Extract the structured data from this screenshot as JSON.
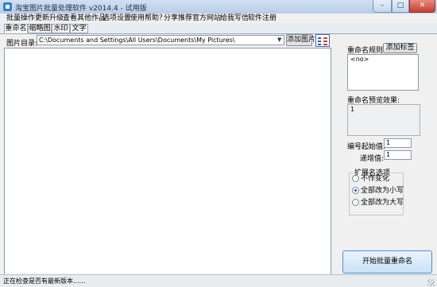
{
  "window": {
    "title": "淘宝图片批量处理软件 v2014.4 - 试用版",
    "minimize_glyph": "–",
    "maximize_glyph": "□",
    "close_glyph": "✕"
  },
  "menu": {
    "items": [
      {
        "label": "批量操作"
      },
      {
        "label": "更新升级"
      },
      {
        "label": "查看其他作品"
      },
      {
        "label": "选项设置"
      },
      {
        "label": "使用帮助？"
      },
      {
        "label": "分享推荐"
      },
      {
        "label": "官方网站"
      },
      {
        "label": "给我写信"
      },
      {
        "label": "软件注册"
      }
    ]
  },
  "tabs": [
    {
      "label": "重命名",
      "active": true
    },
    {
      "label": "缩略图",
      "active": false
    },
    {
      "label": "水印",
      "active": false
    },
    {
      "label": "文字",
      "active": false
    }
  ],
  "directory": {
    "label": "图片目录:",
    "value": "C:\\Documents and Settings\\All Users\\Documents\\My Pictures\\",
    "add_button": "添加图片",
    "dropdown_glyph": "▼"
  },
  "rename": {
    "rule_label": "重命名规则:",
    "add_tag_button": "添加标签",
    "rule_value": "<no>",
    "preview_label": "重命名预览效果:",
    "preview_value": "1",
    "start_label": "编号起始值:",
    "start_value": "1",
    "step_label": "递增值:",
    "step_value": "1"
  },
  "extension": {
    "title": "扩展名选项",
    "options": [
      {
        "label": "不作变化",
        "selected": false
      },
      {
        "label": "全部改为小写",
        "selected": true
      },
      {
        "label": "全部改为大写",
        "selected": false
      }
    ]
  },
  "start_button": "开始批量重命名",
  "status": "正在检查是否有最新版本......",
  "colors": {
    "accent": "#3b6bc4",
    "title_bar": "#c4d7ee",
    "start_button": "#c9e2f6"
  }
}
